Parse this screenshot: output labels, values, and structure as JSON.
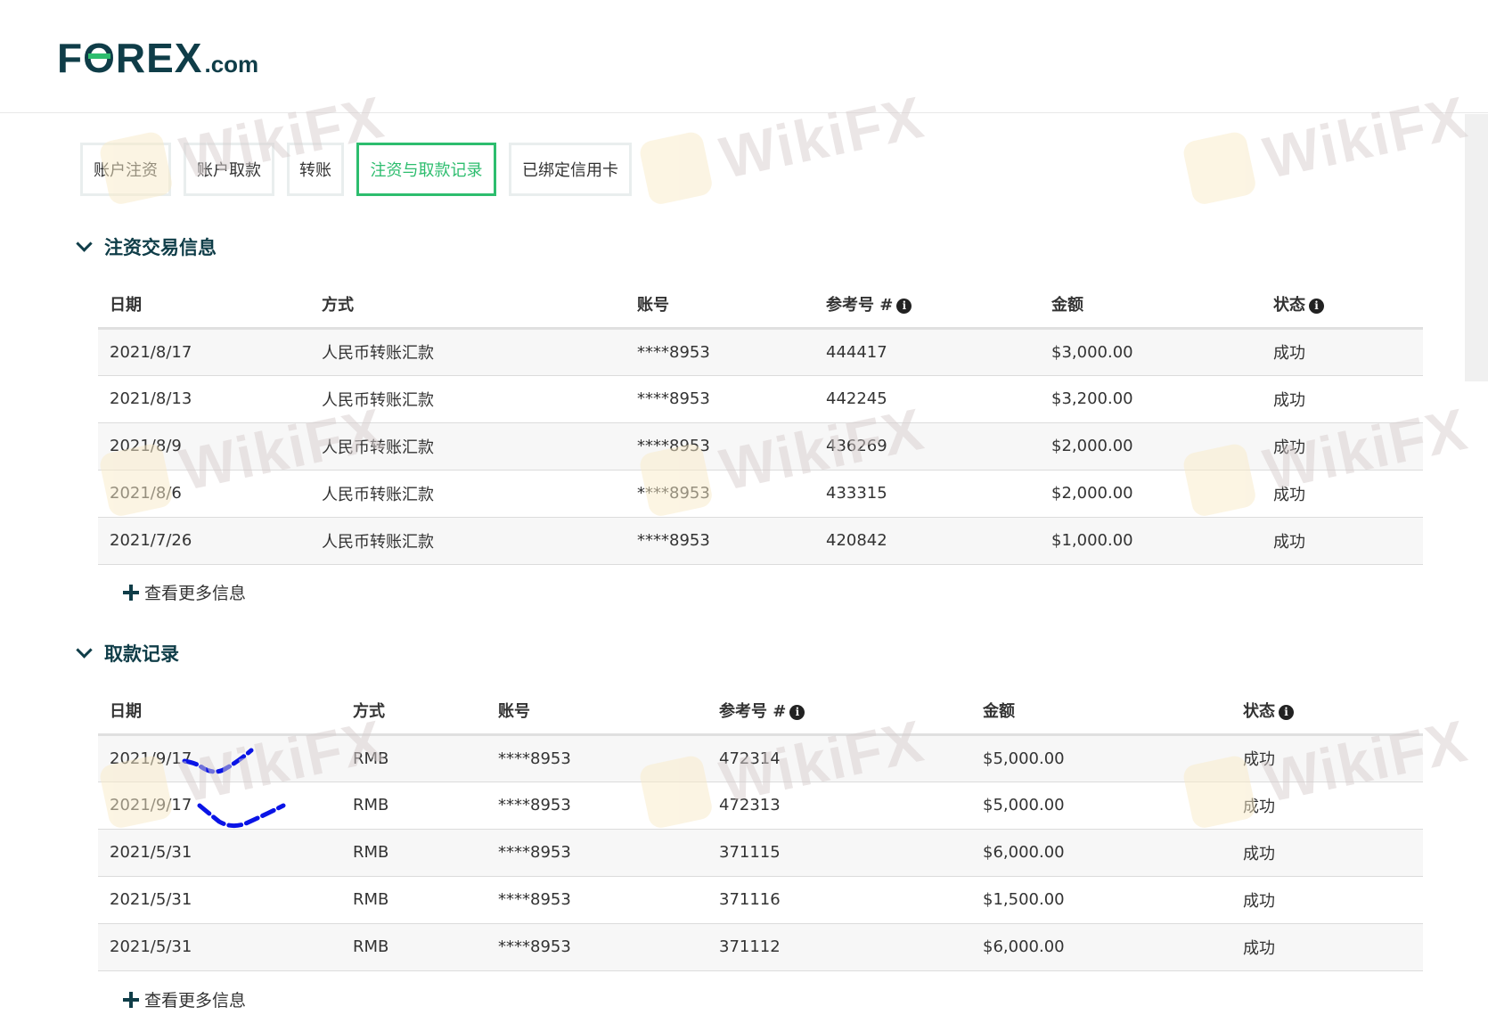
{
  "brand": {
    "logo_prefix": "F",
    "logo_o": "O",
    "logo_rest": "REX",
    "logo_suffix": ".com",
    "primary_color": "#0f3d48",
    "accent_color": "#2dbd6e"
  },
  "tabs": [
    {
      "label": "账户注资",
      "active": false
    },
    {
      "label": "账户取款",
      "active": false
    },
    {
      "label": "转账",
      "active": false
    },
    {
      "label": "注资与取款记录",
      "active": true
    },
    {
      "label": "已绑定信用卡",
      "active": false
    }
  ],
  "deposits": {
    "title": "注资交易信息",
    "columns": [
      "日期",
      "方式",
      "账号",
      "参考号 #",
      "金额",
      "状态"
    ],
    "rows": [
      [
        "2021/8/17",
        "人民币转账汇款",
        "****8953",
        "444417",
        "$3,000.00",
        "成功"
      ],
      [
        "2021/8/13",
        "人民币转账汇款",
        "****8953",
        "442245",
        "$3,200.00",
        "成功"
      ],
      [
        "2021/8/9",
        "人民币转账汇款",
        "****8953",
        "436269",
        "$2,000.00",
        "成功"
      ],
      [
        "2021/8/6",
        "人民币转账汇款",
        "****8953",
        "433315",
        "$2,000.00",
        "成功"
      ],
      [
        "2021/7/26",
        "人民币转账汇款",
        "****8953",
        "420842",
        "$1,000.00",
        "成功"
      ]
    ],
    "more_label": "查看更多信息"
  },
  "withdrawals": {
    "title": "取款记录",
    "columns": [
      "日期",
      "方式",
      "账号",
      "参考号 #",
      "金额",
      "状态"
    ],
    "rows": [
      [
        "2021/9/17",
        "RMB",
        "****8953",
        "472314",
        "$5,000.00",
        "成功"
      ],
      [
        "2021/9/17",
        "RMB",
        "****8953",
        "472313",
        "$5,000.00",
        "成功"
      ],
      [
        "2021/5/31",
        "RMB",
        "****8953",
        "371115",
        "$6,000.00",
        "成功"
      ],
      [
        "2021/5/31",
        "RMB",
        "****8953",
        "371116",
        "$1,500.00",
        "成功"
      ],
      [
        "2021/5/31",
        "RMB",
        "****8953",
        "371112",
        "$6,000.00",
        "成功"
      ]
    ],
    "more_label": "查看更多信息"
  },
  "info_icon_glyph": "i",
  "watermark": {
    "text": "WikiFX"
  }
}
